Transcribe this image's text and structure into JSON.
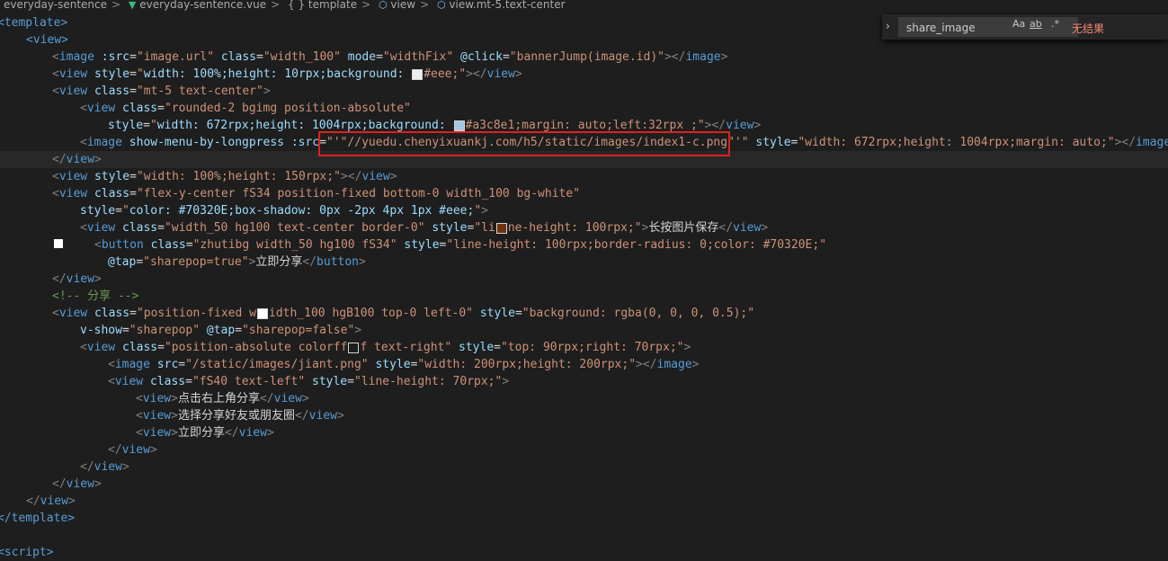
{
  "breadcrumb": [
    "everyday-sentence",
    "everyday-sentence.vue",
    "{ } template",
    "view",
    "view.mt-5.text-center"
  ],
  "find_widget": {
    "query": "share_image",
    "match_case": "Aa",
    "whole_word": "ab",
    "regex": ".*",
    "result": "无结果"
  },
  "code": {
    "l1": "<template>",
    "l2_open": "<view>",
    "l3_src": "\"image.url\"",
    "l3_class": "\"width_100\"",
    "l3_mode": "\"widthFix\"",
    "l3_click": "\"bannerJump(image.id)\"",
    "l4_style": "width: 100%;height: 10rpx;background: ",
    "l4_color": "#eee;",
    "l5_class": "\"mt-5 text-center\"",
    "l6_class": "\"rounded-2 bgimg position-absolute\"",
    "l7_style": "width: 672rpx;height: 1004rpx;background: ",
    "l7_tail": "#a3c8e1;margin: auto;left:32rpx ;",
    "l8_src": "\"//yuedu.chenyixuankj.com/h5/static/images/index1-c.png\"",
    "l8_style": "\"width: 672rpx;height: 1004rpx;margin: auto;\"",
    "l10_style": "\"width: 100%;height: 150rpx;\"",
    "l11_class": "\"flex-y-center fS34 position-fixed bottom-0 width_100 bg-white\"",
    "l12_style": "color: #70320E;box-shadow: 0px -2px 4px 1px #eee;",
    "l13_class": "\"width_50 hg100 text-center border-0\"",
    "l13_style_a": "\"li",
    "l13_style_b": "ne-height: 100rpx;\"",
    "l13_text": "长按图片保存",
    "l14_class": "\"zhutibg width_50 hg100 fS34\"",
    "l14_style": "\"line-height: 100rpx;border-radius: 0;color: #70320E;\"",
    "l15_tap": "\"sharepop=true\"",
    "l15_text": "立即分享",
    "l17_comment": "<!-- 分享 -->",
    "l18_class_a": "\"position-fixed w",
    "l18_class_b": "idth_100 hgB100 top-0 left-0\"",
    "l18_style": "\"background: rgba(0, 0, 0, 0.5);\"",
    "l19_show": "\"sharepop\"",
    "l19_tap": "\"sharepop=false\"",
    "l20_class_a": "\"position-absolute colorff",
    "l20_class_b": "f text-right\"",
    "l20_style": "\"top: 90rpx;right: 70rpx;\"",
    "l21_src": "\"/static/images/jiant.png\"",
    "l21_style": "\"width: 200rpx;height: 200rpx;\"",
    "l22_class": "\"fS40 text-left\"",
    "l22_style": "\"line-height: 70rpx;\"",
    "l23_text": "点击右上角分享",
    "l24_text": "选择分享好友或朋友圈",
    "l25_text": "立即分享",
    "l31_close": "</template>",
    "l33": "<script>"
  }
}
